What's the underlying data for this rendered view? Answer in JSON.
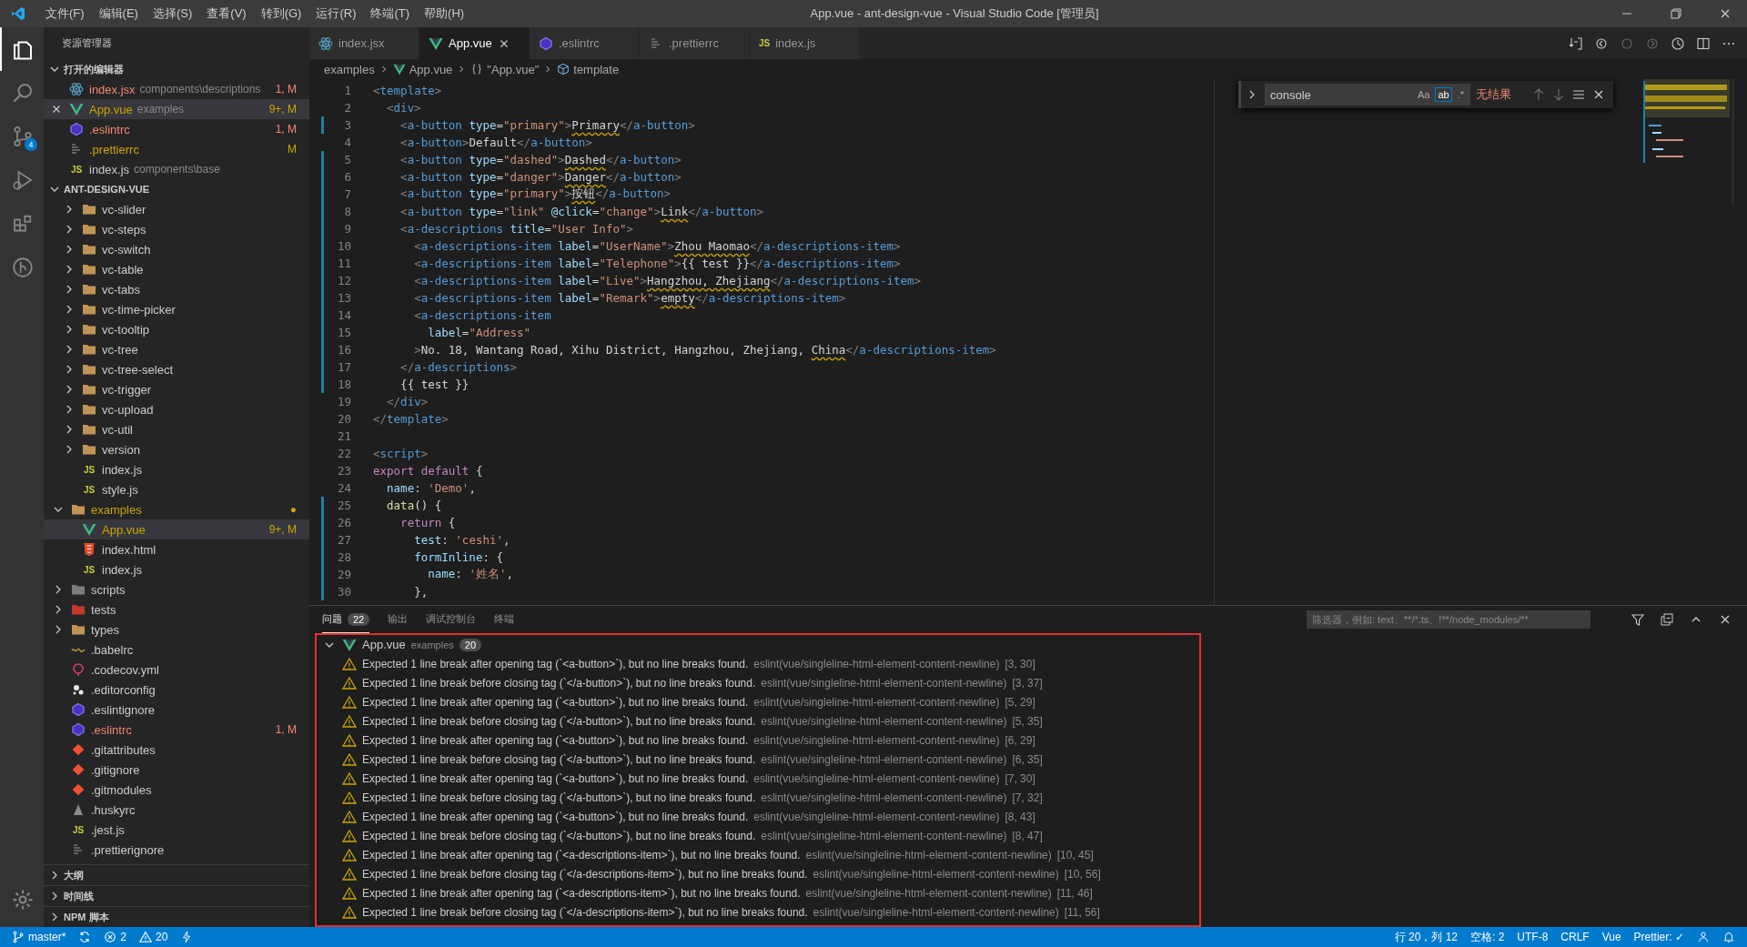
{
  "title_bar": {
    "menu": [
      "文件(F)",
      "编辑(E)",
      "选择(S)",
      "查看(V)",
      "转到(G)",
      "运行(R)",
      "终端(T)",
      "帮助(H)"
    ],
    "title": "App.vue - ant-design-vue - Visual Studio Code [管理员]"
  },
  "activity_bar": {
    "items": [
      {
        "kind": "files",
        "selected": true
      },
      {
        "kind": "search",
        "selected": false
      },
      {
        "kind": "source-control",
        "selected": false,
        "badge": "4"
      },
      {
        "kind": "run",
        "selected": false
      },
      {
        "kind": "extensions",
        "selected": false
      },
      {
        "kind": "git-graph",
        "selected": false
      }
    ]
  },
  "sidebar": {
    "title": "资源管理器",
    "open_editors": {
      "title": "打开的编辑器",
      "expanded": true,
      "items": [
        {
          "label": "index.jsx",
          "path": "components\\descriptions",
          "badge": "1, M",
          "color": "#f48771",
          "kind": "react",
          "selected": false
        },
        {
          "label": "App.vue",
          "path": "examples",
          "badge": "9+, M",
          "color": "#cca700",
          "kind": "vue",
          "selected": true
        },
        {
          "label": ".eslintrc",
          "badge": "1, M",
          "color": "#f48771",
          "kind": "eslint",
          "selected": false
        },
        {
          "label": ".prettierrc",
          "badge": "M",
          "color": "#cca700",
          "kind": "prettier",
          "selected": false
        },
        {
          "label": "index.js",
          "path": "components\\base",
          "color": "#cccccc",
          "kind": "js",
          "icon_text": "JS",
          "selected": false
        }
      ]
    },
    "workspace": {
      "title": "ANT-DESIGN-VUE",
      "expanded": true,
      "tree": [
        {
          "children": [
            {
              "label": "vc-slider",
              "kind": "folder",
              "expanded": false,
              "color": "#cccccc",
              "selected": false
            },
            {
              "label": "vc-steps",
              "kind": "folder",
              "expanded": false,
              "color": "#cccccc",
              "selected": false
            },
            {
              "label": "vc-switch",
              "kind": "folder",
              "expanded": false,
              "color": "#cccccc",
              "selected": false
            },
            {
              "label": "vc-table",
              "kind": "folder",
              "expanded": false,
              "color": "#cccccc",
              "selected": false
            },
            {
              "label": "vc-tabs",
              "kind": "folder",
              "expanded": false,
              "color": "#cccccc",
              "selected": false
            },
            {
              "label": "vc-time-picker",
              "kind": "folder",
              "expanded": false,
              "color": "#cccccc",
              "selected": false
            },
            {
              "label": "vc-tooltip",
              "kind": "folder",
              "expanded": false,
              "color": "#cccccc",
              "selected": false
            },
            {
              "label": "vc-tree",
              "kind": "folder",
              "expanded": false,
              "color": "#cccccc",
              "selected": false
            },
            {
              "label": "vc-tree-select",
              "kind": "folder",
              "expanded": false,
              "color": "#cccccc",
              "selected": false
            },
            {
              "label": "vc-trigger",
              "kind": "folder",
              "expanded": false,
              "color": "#cccccc",
              "selected": false
            },
            {
              "label": "vc-upload",
              "kind": "folder",
              "expanded": false,
              "color": "#cccccc",
              "selected": false
            },
            {
              "label": "vc-util",
              "kind": "folder",
              "expanded": false,
              "color": "#cccccc",
              "selected": false
            },
            {
              "label": "version",
              "kind": "folder",
              "expanded": false,
              "color": "#cccccc",
              "selected": false
            },
            {
              "label": "index.js",
              "kind": "js",
              "icon_text": "JS",
              "color": "#cccccc",
              "selected": false
            },
            {
              "label": "style.js",
              "kind": "js",
              "icon_text": "JS",
              "color": "#cccccc",
              "selected": false
            }
          ]
        },
        {
          "label": "examples",
          "kind": "folder",
          "expanded": true,
          "color": "#cca700",
          "badge": "●",
          "selected": false,
          "children": [
            {
              "label": "App.vue",
              "kind": "vue",
              "badge": "9+, M",
              "color": "#cca700",
              "selected": true
            },
            {
              "label": "index.html",
              "kind": "html",
              "color": "#cccccc",
              "selected": false
            },
            {
              "label": "index.js",
              "kind": "js",
              "icon_text": "JS",
              "color": "#cccccc",
              "selected": false
            }
          ]
        },
        {
          "label": "scripts",
          "kind": "folder-gray",
          "expanded": false,
          "color": "#cccccc",
          "selected": false
        },
        {
          "label": "tests",
          "kind": "folder-red",
          "expanded": false,
          "color": "#cccccc",
          "selected": false
        },
        {
          "label": "types",
          "kind": "folder",
          "expanded": false,
          "color": "#cccccc",
          "selected": false
        },
        {
          "label": ".babelrc",
          "kind": "babel",
          "color": "#cccccc",
          "selected": false
        },
        {
          "label": ".codecov.yml",
          "kind": "yml",
          "color": "#cccccc",
          "selected": false
        },
        {
          "label": ".editorconfig",
          "kind": "editorconfig",
          "color": "#cccccc",
          "selected": false
        },
        {
          "label": ".eslintignore",
          "kind": "eslint",
          "color": "#cccccc",
          "selected": false
        },
        {
          "label": ".eslintrc",
          "kind": "eslint",
          "badge": "1, M",
          "color": "#f48771",
          "selected": false
        },
        {
          "label": ".gitattributes",
          "kind": "git",
          "color": "#cccccc",
          "selected": false
        },
        {
          "label": ".gitignore",
          "kind": "git",
          "color": "#cccccc",
          "selected": false
        },
        {
          "label": ".gitmodules",
          "kind": "git",
          "color": "#cccccc",
          "selected": false
        },
        {
          "label": ".huskyrc",
          "kind": "husky",
          "color": "#cccccc",
          "selected": false
        },
        {
          "label": ".jest.js",
          "kind": "js",
          "icon_text": "JS",
          "color": "#cccccc",
          "selected": false
        },
        {
          "label": ".prettierignore",
          "kind": "prettier",
          "color": "#cccccc",
          "selected": false
        }
      ]
    },
    "bottom_sections": [
      {
        "title": "大纲",
        "expanded": false
      },
      {
        "title": "时间线",
        "expanded": false
      },
      {
        "title": "NPM 脚本",
        "expanded": false
      }
    ]
  },
  "editor": {
    "tabs": [
      {
        "label": "index.jsx",
        "kind": "react",
        "selected": false
      },
      {
        "label": "App.vue",
        "kind": "vue",
        "selected": true
      },
      {
        "label": ".eslintrc",
        "kind": "eslint",
        "selected": false
      },
      {
        "label": ".prettierrc",
        "kind": "prettier",
        "selected": false
      },
      {
        "label": "index.js",
        "kind": "js",
        "icon_text": "JS",
        "selected": false
      }
    ],
    "breadcrumbs": [
      {
        "label": "examples"
      },
      {
        "label": "App.vue",
        "kind": "vue"
      },
      {
        "label": "\"App.vue\"",
        "kind": "braces"
      },
      {
        "label": "template",
        "kind": "cube"
      }
    ],
    "find": {
      "value": "console",
      "options": [
        {
          "label": "Aa",
          "selected": false
        },
        {
          "label": "ab",
          "selected": true
        },
        {
          "label": ".*",
          "selected": false
        }
      ],
      "result": "无结果"
    },
    "lines": [
      {
        "number": "1",
        "modified": false,
        "tokens": [
          {
            "kind": "bracket",
            "text": "<"
          },
          {
            "kind": "tag",
            "text": "template"
          },
          {
            "kind": "bracket",
            "text": ">"
          }
        ]
      },
      {
        "number": "2",
        "modified": false,
        "tokens": [
          {
            "kind": "bracket",
            "text": "  <"
          },
          {
            "kind": "tag",
            "text": "div"
          },
          {
            "kind": "bracket",
            "text": ">"
          }
        ]
      },
      {
        "number": "3",
        "modified": true,
        "tokens": [
          {
            "kind": "bracket",
            "text": "    <"
          },
          {
            "kind": "tag",
            "text": "a-button"
          },
          {
            "kind": "attr",
            "text": " type"
          },
          {
            "kind": "plain",
            "text": "="
          },
          {
            "kind": "str",
            "text": "\"primary\""
          },
          {
            "kind": "bracket",
            "text": ">"
          },
          {
            "kind": "warn",
            "text": "Primary"
          },
          {
            "kind": "bracket",
            "text": "</"
          },
          {
            "kind": "tag",
            "text": "a-button"
          },
          {
            "kind": "bracket",
            "text": ">"
          }
        ]
      },
      {
        "number": "4",
        "modified": false,
        "tokens": [
          {
            "kind": "bracket",
            "text": "    <"
          },
          {
            "kind": "tag",
            "text": "a-button"
          },
          {
            "kind": "bracket",
            "text": ">"
          },
          {
            "kind": "plain",
            "text": "Default"
          },
          {
            "kind": "bracket",
            "text": "</"
          },
          {
            "kind": "tag",
            "text": "a-button"
          },
          {
            "kind": "bracket",
            "text": ">"
          }
        ]
      },
      {
        "number": "5",
        "modified": true,
        "tokens": [
          {
            "kind": "bracket",
            "text": "    <"
          },
          {
            "kind": "tag",
            "text": "a-button"
          },
          {
            "kind": "attr",
            "text": " type"
          },
          {
            "kind": "plain",
            "text": "="
          },
          {
            "kind": "str",
            "text": "\"dashed\""
          },
          {
            "kind": "bracket",
            "text": ">"
          },
          {
            "kind": "warn",
            "text": "Dashed"
          },
          {
            "kind": "bracket",
            "text": "</"
          },
          {
            "kind": "tag",
            "text": "a-button"
          },
          {
            "kind": "bracket",
            "text": ">"
          }
        ]
      },
      {
        "number": "6",
        "modified": true,
        "tokens": [
          {
            "kind": "bracket",
            "text": "    <"
          },
          {
            "kind": "tag",
            "text": "a-button"
          },
          {
            "kind": "attr",
            "text": " type"
          },
          {
            "kind": "plain",
            "text": "="
          },
          {
            "kind": "str",
            "text": "\"danger\""
          },
          {
            "kind": "bracket",
            "text": ">"
          },
          {
            "kind": "warn",
            "text": "Danger"
          },
          {
            "kind": "bracket",
            "text": "</"
          },
          {
            "kind": "tag",
            "text": "a-button"
          },
          {
            "kind": "bracket",
            "text": ">"
          }
        ]
      },
      {
        "number": "7",
        "modified": true,
        "tokens": [
          {
            "kind": "bracket",
            "text": "    <"
          },
          {
            "kind": "tag",
            "text": "a-button"
          },
          {
            "kind": "attr",
            "text": " type"
          },
          {
            "kind": "plain",
            "text": "="
          },
          {
            "kind": "str",
            "text": "\"primary\""
          },
          {
            "kind": "bracket",
            "text": ">"
          },
          {
            "kind": "warn",
            "text": "按钮"
          },
          {
            "kind": "bracket",
            "text": "</"
          },
          {
            "kind": "tag",
            "text": "a-button"
          },
          {
            "kind": "bracket",
            "text": ">"
          }
        ]
      },
      {
        "number": "8",
        "modified": true,
        "tokens": [
          {
            "kind": "bracket",
            "text": "    <"
          },
          {
            "kind": "tag",
            "text": "a-button"
          },
          {
            "kind": "attr",
            "text": " type"
          },
          {
            "kind": "plain",
            "text": "="
          },
          {
            "kind": "str",
            "text": "\"link\""
          },
          {
            "kind": "attr",
            "text": " @click"
          },
          {
            "kind": "plain",
            "text": "="
          },
          {
            "kind": "str",
            "text": "\"change\""
          },
          {
            "kind": "bracket",
            "text": ">"
          },
          {
            "kind": "warn",
            "text": "Link"
          },
          {
            "kind": "bracket",
            "text": "</"
          },
          {
            "kind": "tag",
            "text": "a-button"
          },
          {
            "kind": "bracket",
            "text": ">"
          }
        ]
      },
      {
        "number": "9",
        "modified": true,
        "tokens": [
          {
            "kind": "bracket",
            "text": "    <"
          },
          {
            "kind": "tag",
            "text": "a-descriptions"
          },
          {
            "kind": "attr",
            "text": " title"
          },
          {
            "kind": "plain",
            "text": "="
          },
          {
            "kind": "str",
            "text": "\"User Info\""
          },
          {
            "kind": "bracket",
            "text": ">"
          }
        ]
      },
      {
        "number": "10",
        "modified": true,
        "tokens": [
          {
            "kind": "bracket",
            "text": "      <"
          },
          {
            "kind": "tag",
            "text": "a-descriptions-item"
          },
          {
            "kind": "attr",
            "text": " label"
          },
          {
            "kind": "plain",
            "text": "="
          },
          {
            "kind": "str",
            "text": "\"UserName\""
          },
          {
            "kind": "bracket",
            "text": ">"
          },
          {
            "kind": "warn",
            "text": "Zhou Maomao"
          },
          {
            "kind": "bracket",
            "text": "</"
          },
          {
            "kind": "tag",
            "text": "a-descriptions-item"
          },
          {
            "kind": "bracket",
            "text": ">"
          }
        ]
      },
      {
        "number": "11",
        "modified": true,
        "tokens": [
          {
            "kind": "bracket",
            "text": "      <"
          },
          {
            "kind": "tag",
            "text": "a-descriptions-item"
          },
          {
            "kind": "attr",
            "text": " label"
          },
          {
            "kind": "plain",
            "text": "="
          },
          {
            "kind": "str",
            "text": "\"Telephone\""
          },
          {
            "kind": "bracket",
            "text": ">"
          },
          {
            "kind": "plain",
            "text": "{{ test }}"
          },
          {
            "kind": "bracket",
            "text": "</"
          },
          {
            "kind": "tag",
            "text": "a-descriptions-item"
          },
          {
            "kind": "bracket",
            "text": ">"
          }
        ]
      },
      {
        "number": "12",
        "modified": true,
        "tokens": [
          {
            "kind": "bracket",
            "text": "      <"
          },
          {
            "kind": "tag",
            "text": "a-descriptions-item"
          },
          {
            "kind": "attr",
            "text": " label"
          },
          {
            "kind": "plain",
            "text": "="
          },
          {
            "kind": "str",
            "text": "\"Live\""
          },
          {
            "kind": "bracket",
            "text": ">"
          },
          {
            "kind": "warn",
            "text": "Hangzhou, Zhejiang"
          },
          {
            "kind": "bracket",
            "text": "</"
          },
          {
            "kind": "tag",
            "text": "a-descriptions-item"
          },
          {
            "kind": "bracket",
            "text": ">"
          }
        ]
      },
      {
        "number": "13",
        "modified": true,
        "tokens": [
          {
            "kind": "bracket",
            "text": "      <"
          },
          {
            "kind": "tag",
            "text": "a-descriptions-item"
          },
          {
            "kind": "attr",
            "text": " label"
          },
          {
            "kind": "plain",
            "text": "="
          },
          {
            "kind": "str",
            "text": "\"Remark\""
          },
          {
            "kind": "bracket",
            "text": ">"
          },
          {
            "kind": "warn",
            "text": "empty"
          },
          {
            "kind": "bracket",
            "text": "</"
          },
          {
            "kind": "tag",
            "text": "a-descriptions-item"
          },
          {
            "kind": "bracket",
            "text": ">"
          }
        ]
      },
      {
        "number": "14",
        "modified": true,
        "tokens": [
          {
            "kind": "bracket",
            "text": "      <"
          },
          {
            "kind": "tag",
            "text": "a-descriptions-item"
          }
        ]
      },
      {
        "number": "15",
        "modified": true,
        "tokens": [
          {
            "kind": "attr",
            "text": "        label"
          },
          {
            "kind": "plain",
            "text": "="
          },
          {
            "kind": "str",
            "text": "\"Address\""
          }
        ]
      },
      {
        "number": "16",
        "modified": true,
        "tokens": [
          {
            "kind": "bracket",
            "text": "      >"
          },
          {
            "kind": "plain",
            "text": "No. 18, Wantang Road, Xihu District, Hangzhou, Zhejiang, "
          },
          {
            "kind": "warn",
            "text": "China"
          },
          {
            "kind": "bracket",
            "text": "</"
          },
          {
            "kind": "tag",
            "text": "a-descriptions-item"
          },
          {
            "kind": "bracket",
            "text": ">"
          }
        ]
      },
      {
        "number": "17",
        "modified": true,
        "tokens": [
          {
            "kind": "bracket",
            "text": "    </"
          },
          {
            "kind": "tag",
            "text": "a-descriptions"
          },
          {
            "kind": "bracket",
            "text": ">"
          }
        ]
      },
      {
        "number": "18",
        "modified": true,
        "tokens": [
          {
            "kind": "plain",
            "text": "    {{ test }}"
          }
        ]
      },
      {
        "number": "19",
        "modified": false,
        "tokens": [
          {
            "kind": "bracket",
            "text": "  </"
          },
          {
            "kind": "tag",
            "text": "div"
          },
          {
            "kind": "bracket",
            "text": ">"
          }
        ]
      },
      {
        "number": "20",
        "modified": false,
        "tokens": [
          {
            "kind": "bracket",
            "text": "</"
          },
          {
            "kind": "tag",
            "text": "template"
          },
          {
            "kind": "bracket",
            "text": ">"
          }
        ]
      },
      {
        "number": "21",
        "modified": false
      },
      {
        "number": "22",
        "modified": false,
        "tokens": [
          {
            "kind": "bracket",
            "text": "<"
          },
          {
            "kind": "tag",
            "text": "script"
          },
          {
            "kind": "bracket",
            "text": ">"
          }
        ]
      },
      {
        "number": "23",
        "modified": false,
        "tokens": [
          {
            "kind": "kw",
            "text": "export default"
          },
          {
            "kind": "plain",
            "text": " {"
          }
        ]
      },
      {
        "number": "24",
        "modified": false,
        "tokens": [
          {
            "kind": "prop",
            "text": "  name"
          },
          {
            "kind": "plain",
            "text": ": "
          },
          {
            "kind": "str",
            "text": "'Demo'"
          },
          {
            "kind": "plain",
            "text": ","
          }
        ]
      },
      {
        "number": "25",
        "modified": true,
        "tokens": [
          {
            "kind": "fn",
            "text": "  data"
          },
          {
            "kind": "plain",
            "text": "() {"
          }
        ]
      },
      {
        "number": "26",
        "modified": true,
        "tokens": [
          {
            "kind": "kw",
            "text": "    return"
          },
          {
            "kind": "plain",
            "text": " {"
          }
        ]
      },
      {
        "number": "27",
        "modified": true,
        "tokens": [
          {
            "kind": "prop",
            "text": "      test"
          },
          {
            "kind": "plain",
            "text": ": "
          },
          {
            "kind": "str",
            "text": "'ceshi'"
          },
          {
            "kind": "plain",
            "text": ","
          }
        ]
      },
      {
        "number": "28",
        "modified": true,
        "tokens": [
          {
            "kind": "prop",
            "text": "      formInline"
          },
          {
            "kind": "plain",
            "text": ": {"
          }
        ]
      },
      {
        "number": "29",
        "modified": true,
        "tokens": [
          {
            "kind": "prop",
            "text": "        name"
          },
          {
            "kind": "plain",
            "text": ": "
          },
          {
            "kind": "str",
            "text": "'姓名'"
          },
          {
            "kind": "plain",
            "text": ","
          }
        ]
      },
      {
        "number": "30",
        "modified": true,
        "tokens": [
          {
            "kind": "plain",
            "text": "      },"
          }
        ]
      }
    ]
  },
  "panel": {
    "tabs": [
      {
        "label": "问题",
        "badge": "22",
        "selected": true
      },
      {
        "label": "输出",
        "selected": false
      },
      {
        "label": "调试控制台",
        "selected": false
      },
      {
        "label": "终端",
        "selected": false
      }
    ],
    "filter_placeholder": "筛选器，例如: text、**/*.ts、!**/node_modules/**",
    "group": {
      "file": "App.vue",
      "folder": "examples",
      "count": "20",
      "expanded": true
    },
    "problems": [
      {
        "message": "Expected 1 line break after opening tag (`<a-button>`), but no line breaks found.",
        "source": "eslint(vue/singleline-html-element-content-newline)",
        "position": "[3, 30]"
      },
      {
        "message": "Expected 1 line break before closing tag (`</a-button>`), but no line breaks found.",
        "source": "eslint(vue/singleline-html-element-content-newline)",
        "position": "[3, 37]"
      },
      {
        "message": "Expected 1 line break after opening tag (`<a-button>`), but no line breaks found.",
        "source": "eslint(vue/singleline-html-element-content-newline)",
        "position": "[5, 29]"
      },
      {
        "message": "Expected 1 line break before closing tag (`</a-button>`), but no line breaks found.",
        "source": "eslint(vue/singleline-html-element-content-newline)",
        "position": "[5, 35]"
      },
      {
        "message": "Expected 1 line break after opening tag (`<a-button>`), but no line breaks found.",
        "source": "eslint(vue/singleline-html-element-content-newline)",
        "position": "[6, 29]"
      },
      {
        "message": "Expected 1 line break before closing tag (`</a-button>`), but no line breaks found.",
        "source": "eslint(vue/singleline-html-element-content-newline)",
        "position": "[6, 35]"
      },
      {
        "message": "Expected 1 line break after opening tag (`<a-button>`), but no line breaks found.",
        "source": "eslint(vue/singleline-html-element-content-newline)",
        "position": "[7, 30]"
      },
      {
        "message": "Expected 1 line break before closing tag (`</a-button>`), but no line breaks found.",
        "source": "eslint(vue/singleline-html-element-content-newline)",
        "position": "[7, 32]"
      },
      {
        "message": "Expected 1 line break after opening tag (`<a-button>`), but no line breaks found.",
        "source": "eslint(vue/singleline-html-element-content-newline)",
        "position": "[8, 43]"
      },
      {
        "message": "Expected 1 line break before closing tag (`</a-button>`), but no line breaks found.",
        "source": "eslint(vue/singleline-html-element-content-newline)",
        "position": "[8, 47]"
      },
      {
        "message": "Expected 1 line break after opening tag (`<a-descriptions-item>`), but no line breaks found.",
        "source": "eslint(vue/singleline-html-element-content-newline)",
        "position": "[10, 45]"
      },
      {
        "message": "Expected 1 line break before closing tag (`</a-descriptions-item>`), but no line breaks found.",
        "source": "eslint(vue/singleline-html-element-content-newline)",
        "position": "[10, 56]"
      },
      {
        "message": "Expected 1 line break after opening tag (`<a-descriptions-item>`), but no line breaks found.",
        "source": "eslint(vue/singleline-html-element-content-newline)",
        "position": "[11, 46]"
      },
      {
        "message": "Expected 1 line break before closing tag (`</a-descriptions-item>`), but no line breaks found.",
        "source": "eslint(vue/singleline-html-element-content-newline)",
        "position": "[11, 56]"
      }
    ]
  },
  "status_bar": {
    "left": [
      {
        "kind": "branch",
        "label": "master*"
      },
      {
        "kind": "sync"
      },
      {
        "kind": "error",
        "label": "2"
      },
      {
        "kind": "warning",
        "label": "20"
      },
      {
        "kind": "bolt"
      }
    ],
    "right": [
      "行 20，列 12",
      "空格: 2",
      "UTF-8",
      "CRLF",
      "Vue",
      "Prettier: ✓"
    ]
  }
}
